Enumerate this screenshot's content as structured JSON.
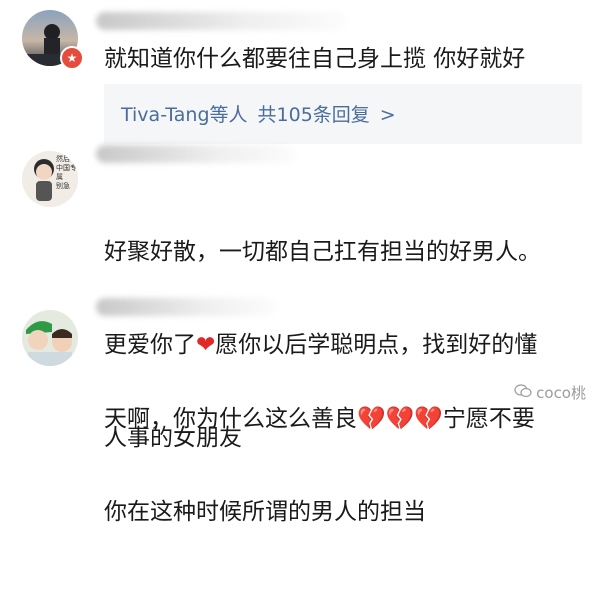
{
  "comments": [
    {
      "text": "就知道你什么都要往自己身上揽 你好就好",
      "badge": "★"
    },
    {
      "text_lines": [
        "好聚好散，一切都自己扛有担当的好男人。",
        "更爱你了",
        "愿你以后学聪明点，找到好的懂",
        "人事的女朋友"
      ],
      "avatar_text": [
        "然后",
        "中国专属",
        "别急"
      ]
    },
    {
      "text_lines": [
        "天啊，你为什么这么善良",
        "宁愿不要",
        "你在这种时候所谓的男人的担当"
      ]
    }
  ],
  "reply": {
    "users": "Tiva-Tang等人",
    "count": "共105条回复",
    "arrow": ">"
  },
  "icons": {
    "heart": "❤",
    "broken_heart": "💔"
  },
  "watermark": {
    "text": "coco桃",
    "icon": "wechat-icon"
  },
  "colors": {
    "link": "#4a6d9c",
    "heart": "#e02a2a",
    "reply_bg": "#f5f6f8"
  }
}
